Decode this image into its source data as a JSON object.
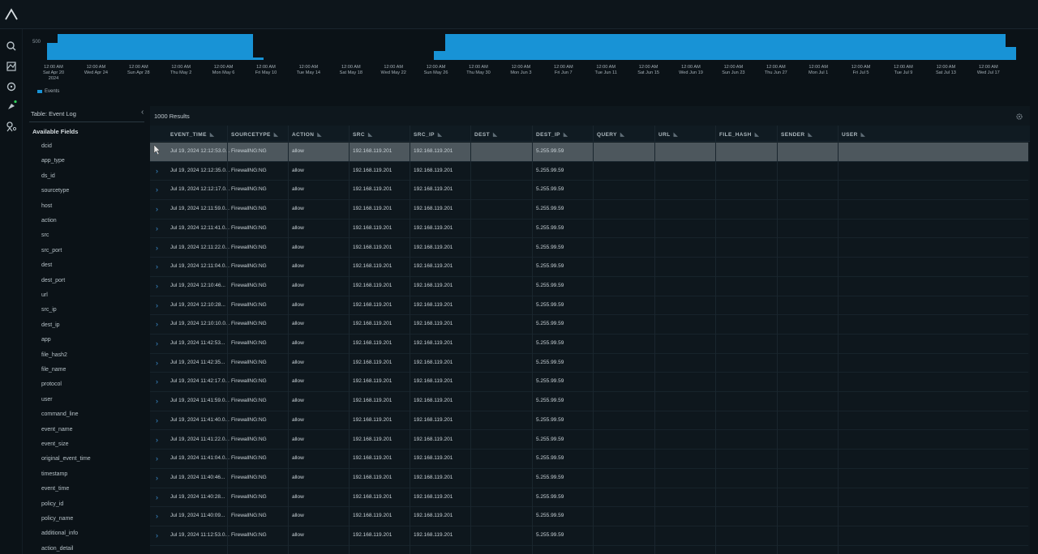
{
  "app": {
    "logo_icon": "caret-logo-icon"
  },
  "nav": [
    "search-icon",
    "dashboard-icon",
    "target-icon",
    "rocket-icon",
    "settings-user-icon"
  ],
  "histogram": {
    "y_tick": "500",
    "legend": "Events",
    "color": "#1893d6",
    "x_labels": [
      {
        "l1": "12:00 AM",
        "l2": "Sat Apr 20",
        "l3": "2024"
      },
      {
        "l1": "12:00 AM",
        "l2": "Wed Apr 24",
        "l3": ""
      },
      {
        "l1": "12:00 AM",
        "l2": "Sun Apr 28",
        "l3": ""
      },
      {
        "l1": "12:00 AM",
        "l2": "Thu May 2",
        "l3": ""
      },
      {
        "l1": "12:00 AM",
        "l2": "Mon May 6",
        "l3": ""
      },
      {
        "l1": "12:00 AM",
        "l2": "Fri May 10",
        "l3": ""
      },
      {
        "l1": "12:00 AM",
        "l2": "Tue May 14",
        "l3": ""
      },
      {
        "l1": "12:00 AM",
        "l2": "Sat May 18",
        "l3": ""
      },
      {
        "l1": "12:00 AM",
        "l2": "Wed May 22",
        "l3": ""
      },
      {
        "l1": "12:00 AM",
        "l2": "Sun May 26",
        "l3": ""
      },
      {
        "l1": "12:00 AM",
        "l2": "Thu May 30",
        "l3": ""
      },
      {
        "l1": "12:00 AM",
        "l2": "Mon Jun 3",
        "l3": ""
      },
      {
        "l1": "12:00 AM",
        "l2": "Fri Jun 7",
        "l3": ""
      },
      {
        "l1": "12:00 AM",
        "l2": "Tue Jun 11",
        "l3": ""
      },
      {
        "l1": "12:00 AM",
        "l2": "Sat Jun 15",
        "l3": ""
      },
      {
        "l1": "12:00 AM",
        "l2": "Wed Jun 19",
        "l3": ""
      },
      {
        "l1": "12:00 AM",
        "l2": "Sun Jun 23",
        "l3": ""
      },
      {
        "l1": "12:00 AM",
        "l2": "Thu Jun 27",
        "l3": ""
      },
      {
        "l1": "12:00 AM",
        "l2": "Mon Jul 1",
        "l3": ""
      },
      {
        "l1": "12:00 AM",
        "l2": "Fri Jul 5",
        "l3": ""
      },
      {
        "l1": "12:00 AM",
        "l2": "Tue Jul 9",
        "l3": ""
      },
      {
        "l1": "12:00 AM",
        "l2": "Sat Jul 13",
        "l3": ""
      },
      {
        "l1": "12:00 AM",
        "l2": "Wed Jul 17",
        "l3": ""
      }
    ],
    "bar_levels": [
      0.65,
      1,
      1,
      1,
      1,
      1,
      1,
      1,
      1,
      1,
      1,
      1,
      1,
      1,
      1,
      1,
      1,
      1,
      1,
      0.1,
      0,
      0,
      0,
      0,
      0,
      0,
      0,
      0,
      0,
      0,
      0,
      0,
      0,
      0,
      0,
      0,
      0.35,
      1,
      1,
      1,
      1,
      1,
      1,
      1,
      1,
      1,
      1,
      1,
      1,
      1,
      1,
      1,
      1,
      1,
      1,
      1,
      1,
      1,
      1,
      1,
      1,
      1,
      1,
      1,
      1,
      1,
      1,
      1,
      1,
      1,
      1,
      1,
      1,
      1,
      1,
      1,
      1,
      1,
      1,
      1,
      1,
      1,
      1,
      1,
      1,
      1,
      1,
      1,
      1,
      0.5
    ]
  },
  "field_panel": {
    "title": "Table: Event Log",
    "subtitle": "Available Fields",
    "fields": [
      "dcid",
      "app_type",
      "ds_id",
      "sourcetype",
      "host",
      "action",
      "src",
      "src_port",
      "dest",
      "dest_port",
      "url",
      "src_ip",
      "dest_ip",
      "app",
      "file_hash2",
      "file_name",
      "protocol",
      "user",
      "command_line",
      "event_name",
      "event_size",
      "original_event_time",
      "timestamp",
      "event_time",
      "policy_id",
      "policy_name",
      "additional_info",
      "action_detail"
    ]
  },
  "results": {
    "count": "1000 Results",
    "columns": [
      "EVENT_TIME",
      "SOURCETYPE",
      "ACTION",
      "SRC",
      "SRC_IP",
      "DEST",
      "DEST_IP",
      "QUERY",
      "URL",
      "FILE_HASH",
      "SENDER",
      "USER"
    ],
    "rows": [
      [
        "Jul 19, 2024 12:12:53.0...",
        "FirewallNG:NG",
        "allow",
        "192.168.119.201",
        "192.168.119.201",
        "",
        "5.255.99.59",
        "",
        "",
        "",
        "",
        ""
      ],
      [
        "Jul 19, 2024 12:12:35.0...",
        "FirewallNG:NG",
        "allow",
        "192.168.119.201",
        "192.168.119.201",
        "",
        "5.255.99.59",
        "",
        "",
        "",
        "",
        ""
      ],
      [
        "Jul 19, 2024 12:12:17.0...",
        "FirewallNG:NG",
        "allow",
        "192.168.119.201",
        "192.168.119.201",
        "",
        "5.255.99.59",
        "",
        "",
        "",
        "",
        ""
      ],
      [
        "Jul 19, 2024 12:11:59.0...",
        "FirewallNG:NG",
        "allow",
        "192.168.119.201",
        "192.168.119.201",
        "",
        "5.255.99.59",
        "",
        "",
        "",
        "",
        ""
      ],
      [
        "Jul 19, 2024 12:11:41.0...",
        "FirewallNG:NG",
        "allow",
        "192.168.119.201",
        "192.168.119.201",
        "",
        "5.255.99.59",
        "",
        "",
        "",
        "",
        ""
      ],
      [
        "Jul 19, 2024 12:11:22.0...",
        "FirewallNG:NG",
        "allow",
        "192.168.119.201",
        "192.168.119.201",
        "",
        "5.255.99.59",
        "",
        "",
        "",
        "",
        ""
      ],
      [
        "Jul 19, 2024 12:11:04.0...",
        "FirewallNG:NG",
        "allow",
        "192.168.119.201",
        "192.168.119.201",
        "",
        "5.255.99.59",
        "",
        "",
        "",
        "",
        ""
      ],
      [
        "Jul 19, 2024 12:10:46...",
        "FirewallNG:NG",
        "allow",
        "192.168.119.201",
        "192.168.119.201",
        "",
        "5.255.99.59",
        "",
        "",
        "",
        "",
        ""
      ],
      [
        "Jul 19, 2024 12:10:28...",
        "FirewallNG:NG",
        "allow",
        "192.168.119.201",
        "192.168.119.201",
        "",
        "5.255.99.59",
        "",
        "",
        "",
        "",
        ""
      ],
      [
        "Jul 19, 2024 12:10:10.0...",
        "FirewallNG:NG",
        "allow",
        "192.168.119.201",
        "192.168.119.201",
        "",
        "5.255.99.59",
        "",
        "",
        "",
        "",
        ""
      ],
      [
        "Jul 19, 2024 11:42:53...",
        "FirewallNG:NG",
        "allow",
        "192.168.119.201",
        "192.168.119.201",
        "",
        "5.255.99.59",
        "",
        "",
        "",
        "",
        ""
      ],
      [
        "Jul 19, 2024 11:42:35...",
        "FirewallNG:NG",
        "allow",
        "192.168.119.201",
        "192.168.119.201",
        "",
        "5.255.99.59",
        "",
        "",
        "",
        "",
        ""
      ],
      [
        "Jul 19, 2024 11:42:17.0...",
        "FirewallNG:NG",
        "allow",
        "192.168.119.201",
        "192.168.119.201",
        "",
        "5.255.99.59",
        "",
        "",
        "",
        "",
        ""
      ],
      [
        "Jul 19, 2024 11:41:59.0...",
        "FirewallNG:NG",
        "allow",
        "192.168.119.201",
        "192.168.119.201",
        "",
        "5.255.99.59",
        "",
        "",
        "",
        "",
        ""
      ],
      [
        "Jul 19, 2024 11:41:40.0...",
        "FirewallNG:NG",
        "allow",
        "192.168.119.201",
        "192.168.119.201",
        "",
        "5.255.99.59",
        "",
        "",
        "",
        "",
        ""
      ],
      [
        "Jul 19, 2024 11:41:22.0...",
        "FirewallNG:NG",
        "allow",
        "192.168.119.201",
        "192.168.119.201",
        "",
        "5.255.99.59",
        "",
        "",
        "",
        "",
        ""
      ],
      [
        "Jul 19, 2024 11:41:04.0...",
        "FirewallNG:NG",
        "allow",
        "192.168.119.201",
        "192.168.119.201",
        "",
        "5.255.99.59",
        "",
        "",
        "",
        "",
        ""
      ],
      [
        "Jul 19, 2024 11:40:46...",
        "FirewallNG:NG",
        "allow",
        "192.168.119.201",
        "192.168.119.201",
        "",
        "5.255.99.59",
        "",
        "",
        "",
        "",
        ""
      ],
      [
        "Jul 19, 2024 11:40:28...",
        "FirewallNG:NG",
        "allow",
        "192.168.119.201",
        "192.168.119.201",
        "",
        "5.255.99.59",
        "",
        "",
        "",
        "",
        ""
      ],
      [
        "Jul 19, 2024 11:40:09...",
        "FirewallNG:NG",
        "allow",
        "192.168.119.201",
        "192.168.119.201",
        "",
        "5.255.99.59",
        "",
        "",
        "",
        "",
        ""
      ],
      [
        "Jul 19, 2024 11:12:53.0...",
        "FirewallNG:NG",
        "allow",
        "192.168.119.201",
        "192.168.119.201",
        "",
        "5.255.99.59",
        "",
        "",
        "",
        "",
        ""
      ]
    ]
  }
}
